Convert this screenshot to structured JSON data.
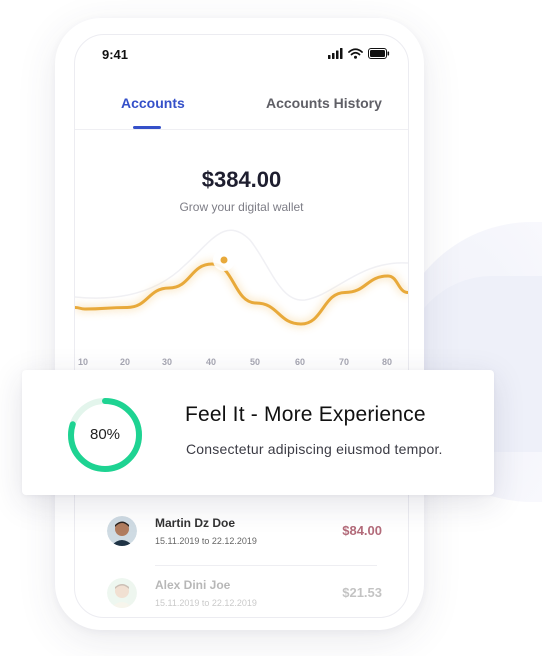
{
  "status": {
    "time": "9:41"
  },
  "tabs": [
    {
      "label": "Accounts",
      "active": true
    },
    {
      "label": "Accounts History",
      "active": false
    }
  ],
  "wallet": {
    "balance": "$384.00",
    "subtitle": "Grow your digital wallet"
  },
  "chart_data": {
    "type": "line",
    "x_ticks": [
      "10",
      "20",
      "30",
      "40",
      "50",
      "60",
      "70",
      "80"
    ],
    "series": [
      {
        "values": [
          0.44,
          0.45,
          0.58,
          0.74,
          0.48,
          0.34,
          0.55,
          0.66
        ],
        "color": "#e8a93a"
      }
    ],
    "highlight_point": {
      "x": "40"
    }
  },
  "feature": {
    "progress_label": "80%",
    "progress": 0.8,
    "title": "Feel It - More Experience",
    "description": "Consectetur adipiscing eiusmod tempor."
  },
  "transactions": [
    {
      "name": "Martin Dz Doe",
      "dates": "15.11.2019 to 22.12.2019",
      "amount": "$84.00"
    },
    {
      "name": "Alex Dini Joe",
      "dates": "15.11.2019 to 22.12.2019",
      "amount": "$21.53"
    }
  ],
  "colors": {
    "accent": "#3550c9",
    "chart": "#e8a93a",
    "progress": "#1ed392",
    "amount": "#b36b7a"
  }
}
